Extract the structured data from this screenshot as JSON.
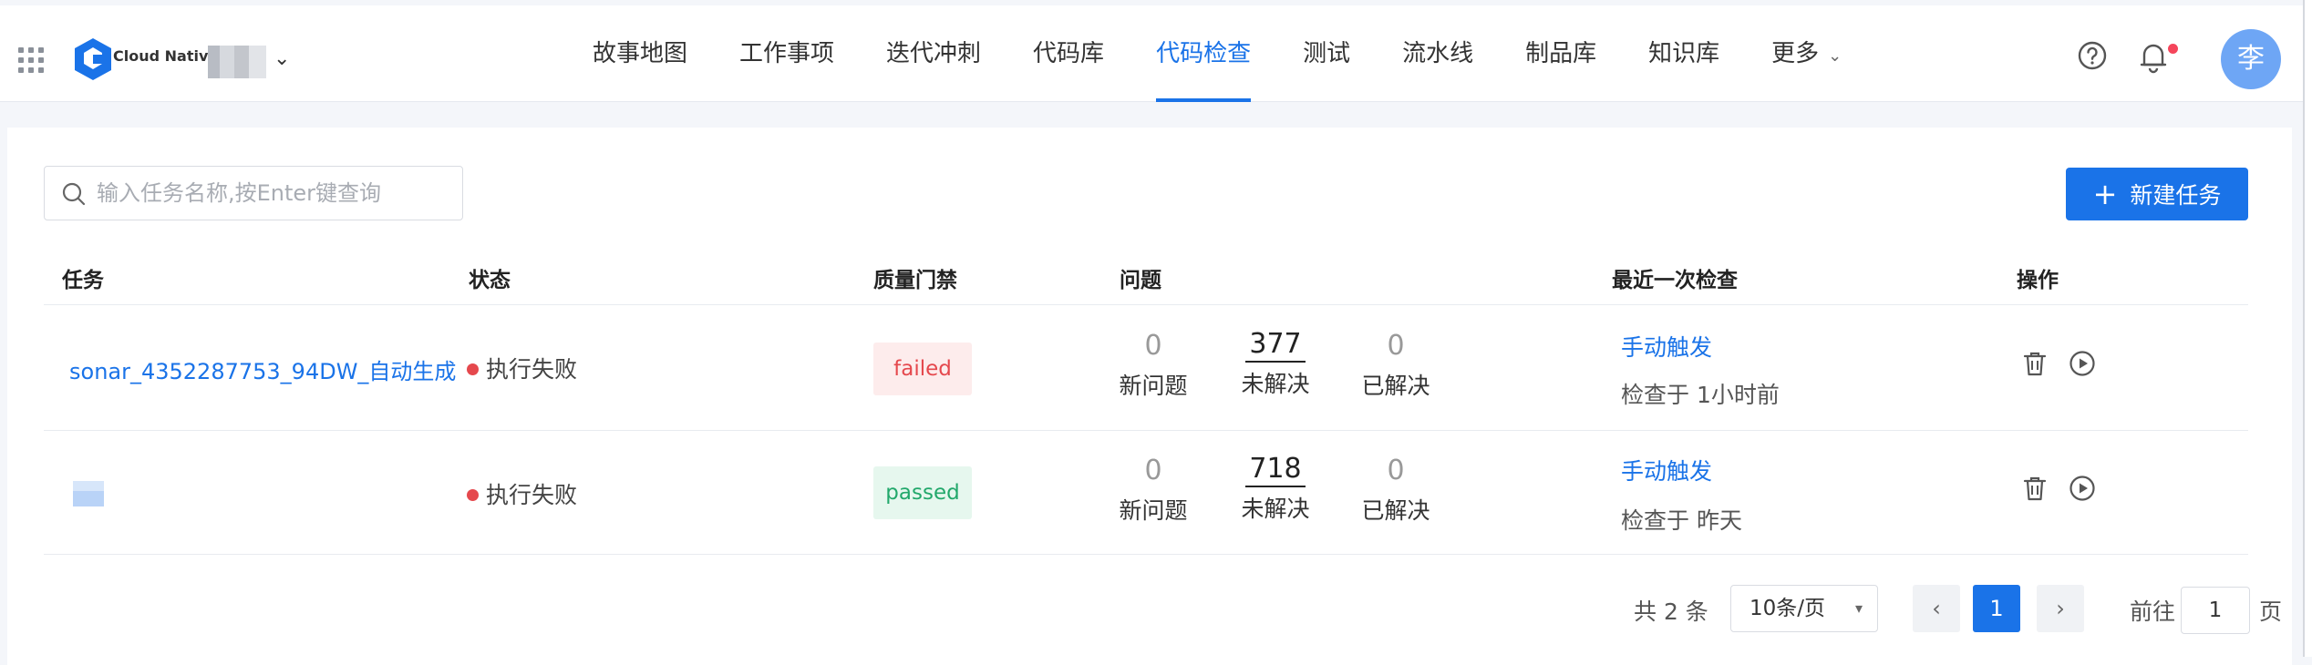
{
  "header": {
    "logo_text": "Cloud Native",
    "nav": [
      {
        "label": "故事地图"
      },
      {
        "label": "工作事项"
      },
      {
        "label": "迭代冲刺"
      },
      {
        "label": "代码库"
      },
      {
        "label": "代码检查",
        "active": true
      },
      {
        "label": "测试"
      },
      {
        "label": "流水线"
      },
      {
        "label": "制品库"
      },
      {
        "label": "知识库"
      },
      {
        "label": "更多"
      }
    ],
    "user_initial": "李",
    "accent_color": "#1a73e8"
  },
  "toolbar": {
    "search_placeholder": "输入任务名称,按Enter键查询",
    "new_task_label": "新建任务"
  },
  "table": {
    "headers": [
      "任务",
      "状态",
      "质量门禁",
      "问题",
      "最近一次检查",
      "操作"
    ],
    "rows": [
      {
        "task": "sonar_4352287753_94DW_自动生成",
        "status": "执行失败",
        "gate": "failed",
        "new_issues": "0",
        "new_label": "新问题",
        "unresolved": "377",
        "unresolved_label": "未解决",
        "resolved": "0",
        "resolved_label": "已解决",
        "trigger": "手动触发",
        "checked_at": "检查于 1小时前"
      },
      {
        "task": "",
        "status": "执行失败",
        "gate": "passed",
        "new_issues": "0",
        "new_label": "新问题",
        "unresolved": "718",
        "unresolved_label": "未解决",
        "resolved": "0",
        "resolved_label": "已解决",
        "trigger": "手动触发",
        "checked_at": "检查于 昨天"
      }
    ]
  },
  "pagination": {
    "total": "共 2 条",
    "page_size": "10条/页",
    "current_page": "1",
    "goto_label": "前往",
    "goto_value": "1",
    "page_suffix": "页"
  }
}
